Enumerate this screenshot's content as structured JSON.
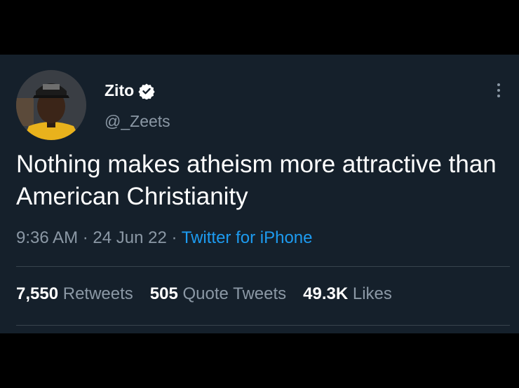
{
  "tweet": {
    "author": {
      "display_name": "Zito",
      "handle": "@_Zeets",
      "verified_icon": "verified-badge-icon"
    },
    "text": "Nothing makes atheism more attractive than American Christianity",
    "time": "9:36 AM",
    "date": "24 Jun 22",
    "separator": "·",
    "source": "Twitter for iPhone",
    "stats": {
      "retweets_count": "7,550",
      "retweets_label": "Retweets",
      "quotes_count": "505",
      "quotes_label": "Quote Tweets",
      "likes_count": "49.3K",
      "likes_label": "Likes"
    }
  },
  "colors": {
    "background": "#15202b",
    "text": "#ffffff",
    "secondary": "#8b98a5",
    "accent": "#1d9bf0"
  }
}
